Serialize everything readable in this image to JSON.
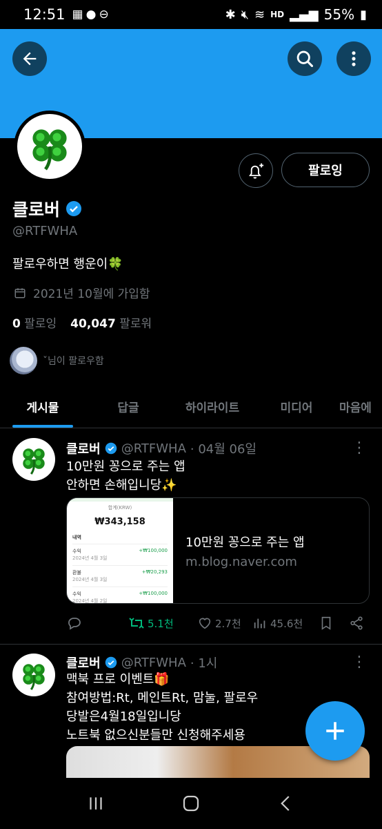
{
  "status_bar": {
    "time": "12:51",
    "battery": "55%",
    "hd_label": "HD"
  },
  "profile": {
    "name": "클로버",
    "handle": "@RTFWHA",
    "bio": "팔로우하면 행운이🍀",
    "joined": "2021년 10월에 가입함",
    "following_count": "0",
    "following_label": "팔로잉",
    "followers_count": "40,047",
    "followers_label": "팔로워",
    "followed_by": "ˇ님이 팔로우함",
    "follow_button": "팔로잉"
  },
  "tabs": [
    {
      "label": "게시물",
      "active": true
    },
    {
      "label": "답글",
      "active": false
    },
    {
      "label": "하이라이트",
      "active": false
    },
    {
      "label": "미디어",
      "active": false
    },
    {
      "label": "마음에",
      "active": false
    }
  ],
  "tweets": [
    {
      "name": "클로버",
      "handle": "@RTFWHA",
      "time": "· 04월 06일",
      "lines": [
        "10만원 꽁으로 주는 앱",
        "안하면 손해입니당✨"
      ],
      "card": {
        "title": "10만원 꽁으로 주는 앱",
        "domain": "m.blog.naver.com",
        "preview": {
          "header": "합계(KRW)",
          "amount": "₩343,158",
          "section": "내역",
          "rows": [
            {
              "label": "수익",
              "date": "2024년 4월 3일",
              "value": "+₩100,000"
            },
            {
              "label": "환불",
              "date": "2024년 4월 3일",
              "value": "+₩20,293"
            },
            {
              "label": "수익",
              "date": "2024년 4월 2일",
              "value": "+₩100,000"
            }
          ]
        }
      },
      "retweets": "5.1천",
      "likes": "2.7천",
      "views": "45.6천"
    },
    {
      "name": "클로버",
      "handle": "@RTFWHA",
      "time": "· 1시",
      "lines": [
        "맥북 프로 이벤트🎁",
        "참여방법:Rt, 메인트Rt, 맘눌, 팔로우",
        "당발은4월18일입니당",
        "노트북 없으신분들만 신청해주세용"
      ]
    }
  ],
  "colors": {
    "accent": "#1d9bf0",
    "retweet_green": "#00ba7c",
    "muted": "#71767b"
  },
  "icons": [
    "back-arrow-icon",
    "search-icon",
    "more-vertical-icon",
    "bell-plus-icon",
    "verified-badge-icon",
    "calendar-icon",
    "reply-icon",
    "retweet-icon",
    "heart-icon",
    "views-icon",
    "bookmark-icon",
    "share-icon",
    "plus-icon"
  ]
}
